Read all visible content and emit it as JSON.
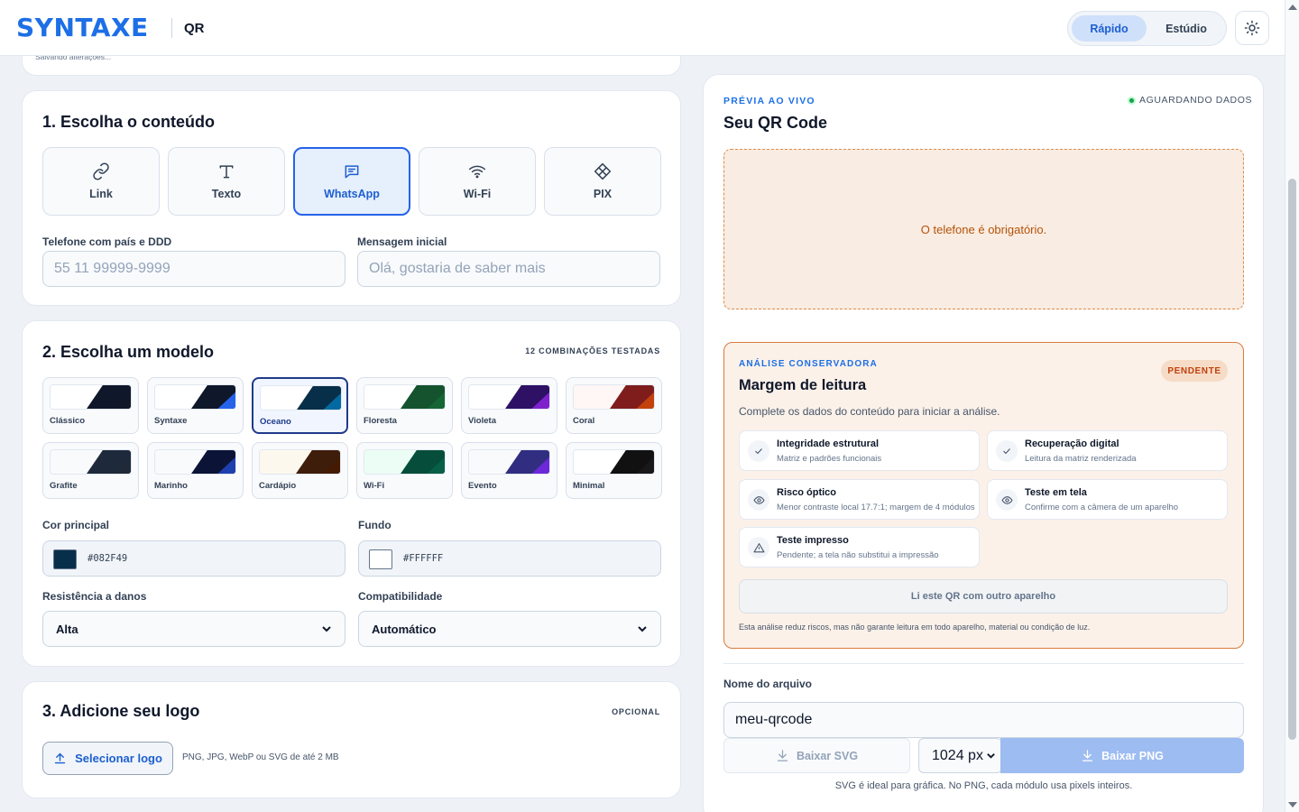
{
  "header": {
    "brand": "SYNTAXE",
    "product": "QR",
    "modes": [
      "Rápido",
      "Estúdio"
    ],
    "active_mode": "Rápido",
    "theme_toggle_icon": "sun-icon"
  },
  "autosave": {
    "text": "Salvando alterações..."
  },
  "content_section": {
    "title": "1. Escolha o conteúdo",
    "types": [
      {
        "label": "Link",
        "icon": "link-icon"
      },
      {
        "label": "Texto",
        "icon": "text-icon"
      },
      {
        "label": "WhatsApp",
        "icon": "message-icon",
        "selected": true
      },
      {
        "label": "Wi-Fi",
        "icon": "wifi-icon"
      },
      {
        "label": "PIX",
        "icon": "pix-icon"
      }
    ],
    "phone": {
      "label": "Telefone com país e DDD",
      "value": "",
      "placeholder": "55 11 99999-9999"
    },
    "message": {
      "label": "Mensagem inicial",
      "value": "",
      "placeholder": "Olá, gostaria de saber mais"
    }
  },
  "model_section": {
    "title": "2. Escolha um modelo",
    "tag": "12 COMBINAÇÕES TESTADAS",
    "themes": [
      {
        "name": "Clássico",
        "bg": "#ffffff",
        "dark": "#0f172a",
        "accent": "#111827"
      },
      {
        "name": "Syntaxe",
        "bg": "#ffffff",
        "dark": "#0f172a",
        "accent": "#2563eb"
      },
      {
        "name": "Oceano",
        "bg": "#ffffff",
        "dark": "#082f49",
        "accent": "#0369a1",
        "selected": true
      },
      {
        "name": "Floresta",
        "bg": "#ffffff",
        "dark": "#14532d",
        "accent": "#166534"
      },
      {
        "name": "Violeta",
        "bg": "#ffffff",
        "dark": "#2e1065",
        "accent": "#7e22ce"
      },
      {
        "name": "Coral",
        "bg": "#fff7f5",
        "dark": "#7f1d1d",
        "accent": "#c2410c"
      },
      {
        "name": "Grafite",
        "bg": "#f8fafc",
        "dark": "#1e293b",
        "accent": "#1f2937"
      },
      {
        "name": "Marinho",
        "bg": "#f8fafc",
        "dark": "#0b1437",
        "accent": "#1e40af"
      },
      {
        "name": "Cardápio",
        "bg": "#fdf8ee",
        "dark": "#3f1d0b",
        "accent": "#451a03"
      },
      {
        "name": "Wi-Fi",
        "bg": "#ecfdf5",
        "dark": "#064e3b",
        "accent": "#065f46"
      },
      {
        "name": "Evento",
        "bg": "#f8fafc",
        "dark": "#312e81",
        "accent": "#6d28d9"
      },
      {
        "name": "Minimal",
        "bg": "#ffffff",
        "dark": "#111111",
        "accent": "#18181b"
      }
    ],
    "primary_color": {
      "label": "Cor principal",
      "value": "#082F49"
    },
    "background_color": {
      "label": "Fundo",
      "value": "#FFFFFF"
    },
    "error_correction": {
      "label": "Resistência a danos",
      "value": "Alta"
    },
    "compatibility": {
      "label": "Compatibilidade",
      "value": "Automático"
    }
  },
  "logo_section": {
    "title": "3. Adicione seu logo",
    "tag": "OPCIONAL",
    "button": "Selecionar logo",
    "hint": "PNG, JPG, WebP ou SVG de até 2 MB"
  },
  "preview": {
    "kicker": "PRÉVIA AO VIVO",
    "status": "AGUARDANDO DADOS",
    "status_color": "#16a34a",
    "title": "Seu QR Code",
    "error": "O telefone é obrigatório."
  },
  "analysis": {
    "kicker": "ANÁLISE CONSERVADORA",
    "badge": "PENDENTE",
    "title": "Margem de leitura",
    "description": "Complete os dados do conteúdo para iniciar a análise.",
    "checks": [
      {
        "title": "Integridade estrutural",
        "sub": "Matriz e padrões funcionais",
        "icon": "check-icon"
      },
      {
        "title": "Recuperação digital",
        "sub": "Leitura da matriz renderizada",
        "icon": "check-icon"
      },
      {
        "title": "Risco óptico",
        "sub": "Menor contraste local 17.7:1; margem de 4 módulos",
        "icon": "eye-icon"
      },
      {
        "title": "Teste em tela",
        "sub": "Confirme com a câmera de um aparelho",
        "icon": "eye-icon"
      },
      {
        "title": "Teste impresso",
        "sub": "Pendente; a tela não substitui a impressão",
        "icon": "warning-icon"
      }
    ],
    "other_device_button": "Li este QR com outro aparelho",
    "footnote": "Esta análise reduz riscos, mas não garante leitura em todo aparelho, material ou condição de luz."
  },
  "export": {
    "filename_label": "Nome do arquivo",
    "filename_value": "meu-qrcode",
    "svg_button": "Baixar SVG",
    "size": "1024 px",
    "png_button": "Baixar PNG",
    "hint": "SVG é ideal para gráfica. No PNG, cada módulo usa pixels inteiros."
  }
}
